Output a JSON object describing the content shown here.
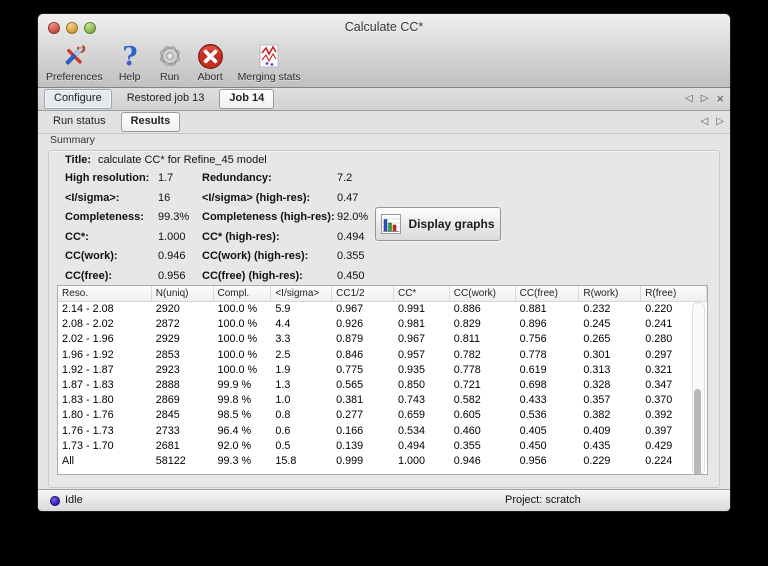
{
  "window": {
    "title": "Calculate CC*"
  },
  "toolbar": {
    "items": [
      {
        "label": "Preferences",
        "icon": "preferences-icon"
      },
      {
        "label": "Help",
        "icon": "help-icon"
      },
      {
        "label": "Run",
        "icon": "run-icon"
      },
      {
        "label": "Abort",
        "icon": "abort-icon"
      },
      {
        "label": "Merging stats",
        "icon": "merging-stats-icon"
      }
    ]
  },
  "nav": {
    "main_tabs": [
      {
        "label": "Configure",
        "state": "outlined"
      },
      {
        "label": "Restored job 13",
        "state": "plain"
      },
      {
        "label": "Job 14",
        "state": "active"
      }
    ],
    "sub_tabs": [
      {
        "label": "Run status",
        "state": "plain"
      },
      {
        "label": "Results",
        "state": "active"
      }
    ],
    "glyphs": {
      "prev": "◁",
      "next": "▷",
      "close": "×"
    }
  },
  "summary": {
    "section_label": "Summary",
    "title_label": "Title:",
    "title_value": "calculate CC* for Refine_45 model",
    "rows": [
      {
        "l1": "High resolution:",
        "v1": "1.7",
        "l2": "Redundancy:",
        "v2": "7.2"
      },
      {
        "l1": "<I/sigma>:",
        "v1": "16",
        "l2": "<I/sigma> (high-res):",
        "v2": "0.47"
      },
      {
        "l1": "Completeness:",
        "v1": "99.3%",
        "l2": "Completeness (high-res):",
        "v2": "92.0%"
      },
      {
        "l1": "CC*:",
        "v1": "1.000",
        "l2": "CC* (high-res):",
        "v2": "0.494"
      },
      {
        "l1": "CC(work):",
        "v1": "0.946",
        "l2": "CC(work) (high-res):",
        "v2": "0.355"
      },
      {
        "l1": "CC(free):",
        "v1": "0.956",
        "l2": "CC(free) (high-res):",
        "v2": "0.450"
      }
    ],
    "display_graphs_label": "Display graphs"
  },
  "table": {
    "columns": [
      "Reso.",
      "N(uniq)",
      "Compl.",
      "<I/sigma>",
      "CC1/2",
      "CC*",
      "CC(work)",
      "CC(free)",
      "R(work)",
      "R(free)"
    ],
    "rows": [
      [
        "2.14 - 2.08",
        "2920",
        "100.0 %",
        "5.9",
        "0.967",
        "0.991",
        "0.886",
        "0.881",
        "0.232",
        "0.220"
      ],
      [
        "2.08 - 2.02",
        "2872",
        "100.0 %",
        "4.4",
        "0.926",
        "0.981",
        "0.829",
        "0.896",
        "0.245",
        "0.241"
      ],
      [
        "2.02 - 1.96",
        "2929",
        "100.0 %",
        "3.3",
        "0.879",
        "0.967",
        "0.811",
        "0.756",
        "0.265",
        "0.280"
      ],
      [
        "1.96 - 1.92",
        "2853",
        "100.0 %",
        "2.5",
        "0.846",
        "0.957",
        "0.782",
        "0.778",
        "0.301",
        "0.297"
      ],
      [
        "1.92 - 1.87",
        "2923",
        "100.0 %",
        "1.9",
        "0.775",
        "0.935",
        "0.778",
        "0.619",
        "0.313",
        "0.321"
      ],
      [
        "1.87 - 1.83",
        "2888",
        "99.9 %",
        "1.3",
        "0.565",
        "0.850",
        "0.721",
        "0.698",
        "0.328",
        "0.347"
      ],
      [
        "1.83 - 1.80",
        "2869",
        "99.8 %",
        "1.0",
        "0.381",
        "0.743",
        "0.582",
        "0.433",
        "0.357",
        "0.370"
      ],
      [
        "1.80 - 1.76",
        "2845",
        "98.5 %",
        "0.8",
        "0.277",
        "0.659",
        "0.605",
        "0.536",
        "0.382",
        "0.392"
      ],
      [
        "1.76 - 1.73",
        "2733",
        "96.4 %",
        "0.6",
        "0.166",
        "0.534",
        "0.460",
        "0.405",
        "0.409",
        "0.397"
      ],
      [
        "1.73 - 1.70",
        "2681",
        "92.0 %",
        "0.5",
        "0.139",
        "0.494",
        "0.355",
        "0.450",
        "0.435",
        "0.429"
      ],
      [
        "All",
        "58122",
        "99.3 %",
        "15.8",
        "0.999",
        "1.000",
        "0.946",
        "0.956",
        "0.229",
        "0.224"
      ]
    ]
  },
  "statusbar": {
    "status": "Idle",
    "project_label": "Project: scratch"
  },
  "colors": {
    "accent_blue": "#2f62cc",
    "abort_red": "#c42f24",
    "status_dot_blue": "#3a23c8",
    "bar_blue": "#2b50c8",
    "bar_green": "#2fa12f",
    "bar_red": "#cc2a2a"
  }
}
